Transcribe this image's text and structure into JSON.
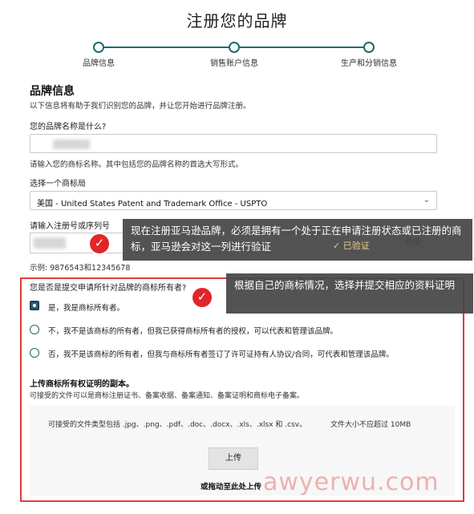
{
  "page_title": "注册您的品牌",
  "steps": [
    {
      "label": "品牌信息"
    },
    {
      "label": "销售账户信息"
    },
    {
      "label": "生产和分销信息"
    }
  ],
  "brand_section": {
    "title": "品牌信息",
    "description": "以下信息将有助于我们识别您的品牌，并让您开始进行品牌注册。",
    "name_label": "您的品牌名称是什么?",
    "name_hint": "请输入您的商标名称。其中包括您的品牌名称的首选大写形式。",
    "office_label": "选择一个商标局",
    "office_value": "美国 - United States Patent and Trademark Office - USPTO",
    "reg_label": "请输入注册号或序列号",
    "verified_text": "✓ 已验证",
    "verify_button": "验证",
    "example_text": "示例: 9876543和12345678"
  },
  "annotations": {
    "callout_1": "现在注册亚马逊品牌，必须是拥有一个处于正在申请注册状态或已注册的商标，亚马逊会对这一列进行验证",
    "callout_2": "根据自己的商标情况，选择并提交相应的资料证明",
    "check_mark": "✓"
  },
  "owner_question": {
    "label": "您是否是提交申请所针对品牌的商标所有者?",
    "options": [
      {
        "label": "是，我是商标所有者。",
        "selected": true
      },
      {
        "label": "不，我不是该商标的所有者，但我已获得商标所有者的授权，可以代表和管理该品牌。",
        "selected": false
      },
      {
        "label": "否，我不是该商标的所有者，但我与商标所有者签订了许可证持有人协议/合同，可代表和管理该品牌。",
        "selected": false
      }
    ]
  },
  "upload": {
    "title": "上传商标所有权证明的副本。",
    "description": "可接受的文件可以是商标注册证书、备案收据、备案通知、备案证明和商标电子备案。",
    "types_text": "可接受的文件类型包括 .jpg、.png、.pdf、.doc、.docx、.xls、.xlsx 和 .csv。",
    "size_text": "文件大小不应超过 10MB",
    "button_label": "上传",
    "drag_text": "或拖动至此处上传"
  },
  "watermark": "awyerwu.com",
  "colors": {
    "accent": "#1e6b6b",
    "highlight_frame": "#e23b3b",
    "badge": "#e0262a",
    "overlay": "#464646"
  }
}
